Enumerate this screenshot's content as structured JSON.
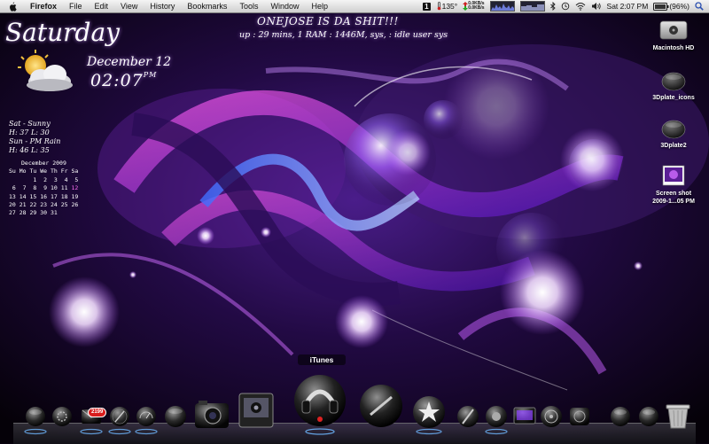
{
  "menubar": {
    "app_name": "Firefox",
    "menus": [
      "File",
      "Edit",
      "View",
      "History",
      "Bookmarks",
      "Tools",
      "Window",
      "Help"
    ],
    "space_number": "1",
    "temperature": "135°",
    "net_up": "0.0KB/s",
    "net_down": "0.0KB/s",
    "clock": "Sat 2:07 PM",
    "battery": "(96%)"
  },
  "desktop_widgets": {
    "day": "Saturday",
    "date": "December 12",
    "time": "02:07",
    "time_ampm": "PM",
    "headline": "ONEJOSE IS DA SHIT!!!",
    "stats": "up : 29 mins, 1 RAM : 1446M, sys, : idle user sys",
    "weather": {
      "today_line": "Sat - Sunny",
      "today_temps": "H: 37 L: 30",
      "tomorrow_line": "Sun - PM Rain",
      "tomorrow_temps": "H: 46 L: 35"
    }
  },
  "calendar": {
    "title": "December 2009",
    "weekdays": "Su Mo Tu We Th Fr Sa",
    "weeks": [
      "       1  2  3  4  5",
      " 6  7  8  9 10 11 ",
      "13 14 15 16 17 18 19",
      "20 21 22 23 24 25 26",
      "27 28 29 30 31"
    ],
    "today": "12"
  },
  "desktop_icons": [
    {
      "label": "Macintosh HD"
    },
    {
      "label": "3Dplate_icons"
    },
    {
      "label": "3Dplate2"
    },
    {
      "label_line1": "Screen shot",
      "label_line2": "2009-1...05 PM"
    }
  ],
  "dock": {
    "hover_label": "iTunes",
    "mail_badge": "2199",
    "icons": [
      "finder",
      "system-preferences",
      "mail",
      "safari",
      "dashboard",
      "camera",
      "photos",
      "photo-booth",
      "itunes",
      "quill",
      "imovie",
      "terminal",
      "ipod",
      "dvd-player",
      "disk-utility",
      "fan",
      "ipod-2",
      "trash"
    ]
  }
}
